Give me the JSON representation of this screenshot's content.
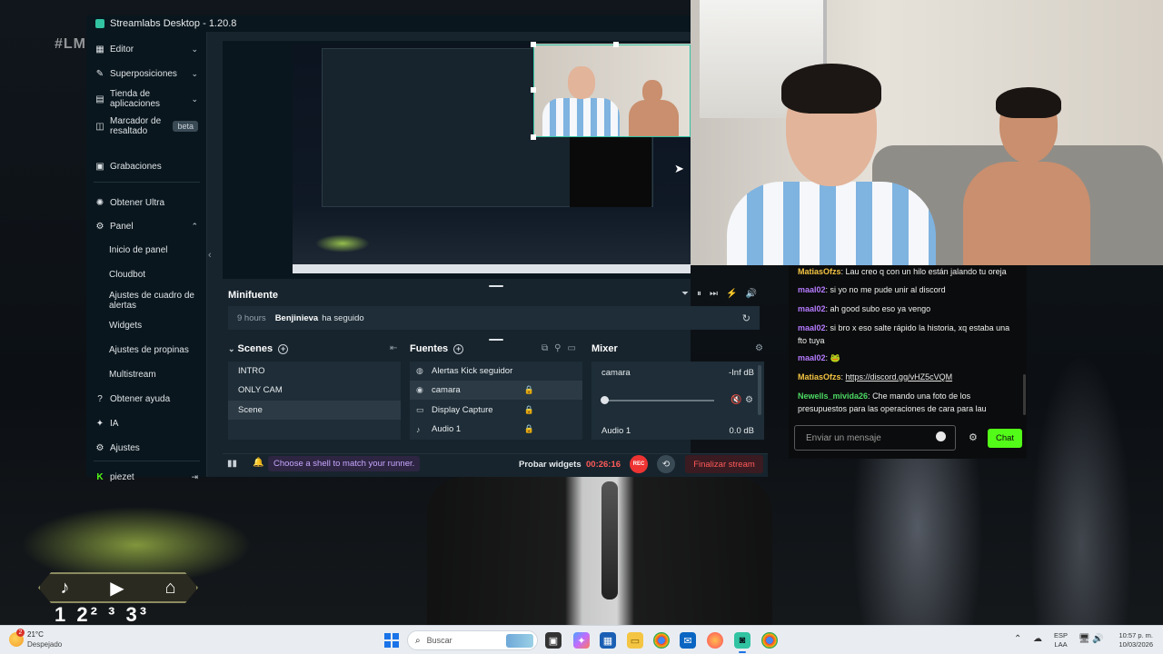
{
  "background": {
    "hashtag": "#LM",
    "score_text": "1 2² ³ 3³"
  },
  "window": {
    "title": "Streamlabs Desktop - 1.20.8"
  },
  "sidebar": {
    "items": [
      {
        "label": "Editor",
        "icon": "editor-icon"
      },
      {
        "label": "Superposiciones",
        "icon": "overlays-icon"
      },
      {
        "label": "Tienda de aplicaciones",
        "icon": "store-icon"
      },
      {
        "label": "Marcador de resaltado",
        "icon": "highlight-icon",
        "badge": "beta"
      },
      {
        "label": "Grabaciones",
        "icon": "recordings-icon"
      },
      {
        "label": "Obtener Ultra",
        "icon": "ultra-icon"
      },
      {
        "label": "Panel",
        "icon": "dashboard-icon"
      }
    ],
    "panel_subitems": [
      "Inicio de panel",
      "Cloudbot",
      "Ajustes de cuadro de alertas",
      "Widgets",
      "Ajustes de propinas",
      "Multistream"
    ],
    "bottom_items": [
      {
        "label": "Obtener ayuda",
        "icon": "help-icon"
      },
      {
        "label": "IA",
        "icon": "ai-icon"
      },
      {
        "label": "Ajustes",
        "icon": "settings-icon"
      }
    ],
    "account": {
      "label": "piezet",
      "icon": "kick-icon"
    }
  },
  "minifeed": {
    "title": "Minifuente",
    "event": {
      "time": "9 hours",
      "user": "Benjinieva",
      "action": "ha seguido"
    }
  },
  "scenes": {
    "title": "Scenes",
    "items": [
      "INTRO",
      "ONLY CAM",
      "Scene"
    ],
    "selected": "Scene"
  },
  "sources": {
    "title": "Fuentes",
    "items": [
      {
        "label": "Alertas Kick seguidor",
        "icon": "globe-icon",
        "locked": false
      },
      {
        "label": "camara",
        "icon": "camera-icon",
        "locked": true
      },
      {
        "label": "Display Capture",
        "icon": "monitor-icon",
        "locked": true
      },
      {
        "label": "Audio 1",
        "icon": "mic-icon",
        "locked": true
      }
    ],
    "selected": "camara"
  },
  "mixer": {
    "title": "Mixer",
    "items": [
      {
        "label": "camara",
        "level": "-Inf dB"
      },
      {
        "label": "Audio 1",
        "level": "0.0 dB"
      }
    ]
  },
  "footer": {
    "shell_message": "Choose a shell to match your runner.",
    "test_widgets": "Probar widgets",
    "timer": "00:26:16",
    "rec_label": "REC",
    "end_stream": "Finalizar stream"
  },
  "chat": {
    "messages": [
      {
        "user": "MatiasOfzs",
        "color": "#f5c542",
        "text": "Lau creo q con un hilo están jalando tu oreja"
      },
      {
        "user": "maal02",
        "color": "#b57bff",
        "text": "si yo no me pude unir al discord"
      },
      {
        "user": "maal02",
        "color": "#b57bff",
        "text": "ah good subo eso ya vengo"
      },
      {
        "user": "maal02",
        "color": "#b57bff",
        "text": "si bro x eso salte rápido la historia, xq estaba una fto tuya"
      },
      {
        "user": "maal02",
        "color": "#b57bff",
        "text": "🐸"
      },
      {
        "user": "MatiasOfzs",
        "color": "#f5c542",
        "text": "https://discord.gg/vHZ5cVQM",
        "link": true
      },
      {
        "user": "Newells_mivida26",
        "color": "#4cd964",
        "text": "Che mando una foto de los presupuestos para las operaciones de cara para lau"
      }
    ],
    "input_placeholder": "Enviar un mensaje",
    "send_label": "Chat",
    "accent": "#53fc18"
  },
  "taskbar": {
    "weather_temp": "21°C",
    "weather_desc": "Despejado",
    "weather_badge": "2",
    "search_placeholder": "Buscar",
    "lang_line1": "ESP",
    "lang_line2": "LAA",
    "time": "10:57 p. m.",
    "date": "10/03/2026"
  }
}
